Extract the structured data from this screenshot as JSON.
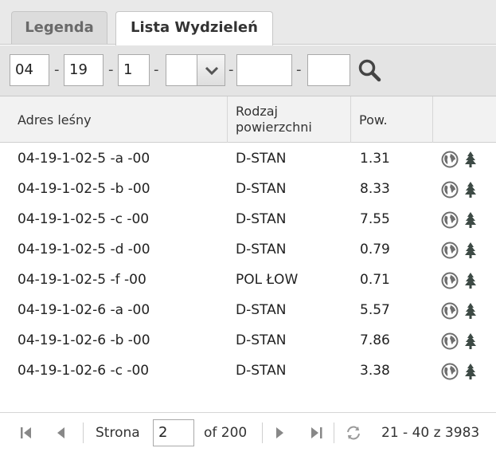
{
  "tabs": [
    {
      "label": "Legenda",
      "active": false
    },
    {
      "label": "Lista Wydzieleń",
      "active": true
    }
  ],
  "filter": {
    "field1": "04",
    "field2": "19",
    "field3": "1",
    "select_value": "",
    "field5": "",
    "field6": "",
    "separator": "-"
  },
  "table": {
    "headers": {
      "address": "Adres leśny",
      "surface_line1": "Rodzaj",
      "surface_line2": "powierzchni",
      "area": "Pow."
    },
    "rows": [
      {
        "address": "04-19-1-02-5 -a -00",
        "type": "D-STAN",
        "area": "1.31"
      },
      {
        "address": "04-19-1-02-5 -b -00",
        "type": "D-STAN",
        "area": "8.33"
      },
      {
        "address": "04-19-1-02-5 -c -00",
        "type": "D-STAN",
        "area": "7.55"
      },
      {
        "address": "04-19-1-02-5 -d -00",
        "type": "D-STAN",
        "area": "0.79"
      },
      {
        "address": "04-19-1-02-5 -f -00",
        "type": "POL ŁOW",
        "area": "0.71"
      },
      {
        "address": "04-19-1-02-6 -a -00",
        "type": "D-STAN",
        "area": "5.57"
      },
      {
        "address": "04-19-1-02-6 -b -00",
        "type": "D-STAN",
        "area": "7.86"
      },
      {
        "address": "04-19-1-02-6 -c -00",
        "type": "D-STAN",
        "area": "3.38"
      }
    ],
    "row_icons": [
      "globe-icon",
      "tree-icon"
    ]
  },
  "pager": {
    "page_label": "Strona",
    "page_value": "2",
    "of_label": "of 200",
    "range_text": "21 - 40 z 3983"
  },
  "colors": {
    "tabbar_bg": "#e9e9e9",
    "filter_bg": "#e4e4e4",
    "header_bg": "#f2f2f2",
    "icon_gray": "#6e6e6e",
    "tree_dark": "#3d4a45"
  }
}
